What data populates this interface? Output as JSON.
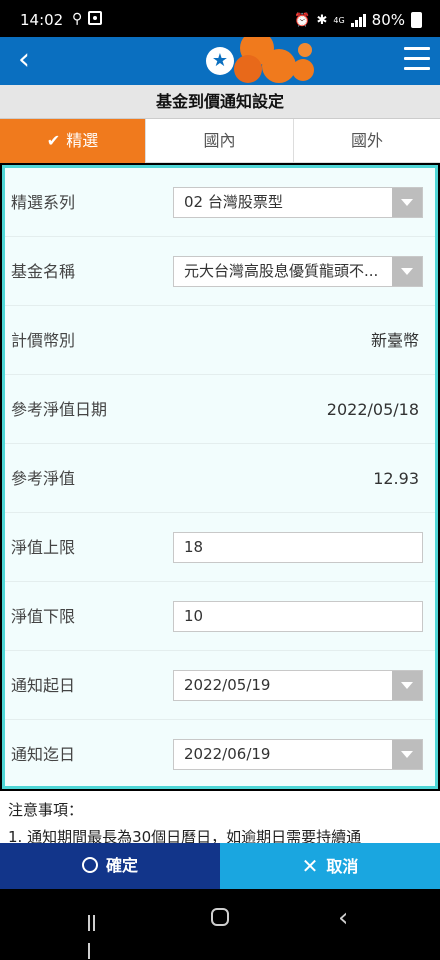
{
  "status_bar": {
    "time": "14:02",
    "network": "4G",
    "battery": "80%"
  },
  "app_bar": {
    "back_icon": "chevron-left-icon",
    "menu_icon": "hamburger-icon",
    "logo_icon": "bank-logo-icon"
  },
  "page_title": "基金到價通知設定",
  "tabs": [
    {
      "label": "精選",
      "active": true
    },
    {
      "label": "國內",
      "active": false
    },
    {
      "label": "國外",
      "active": false
    }
  ],
  "form": {
    "series": {
      "label": "精選系列",
      "value": "02 台灣股票型"
    },
    "fund_name": {
      "label": "基金名稱",
      "value": "元大台灣高股息優質龍頭不..."
    },
    "currency": {
      "label": "計價幣別",
      "value": "新臺幣"
    },
    "nav_date": {
      "label": "參考淨值日期",
      "value": "2022/05/18"
    },
    "nav": {
      "label": "參考淨值",
      "value": "12.93"
    },
    "upper_limit": {
      "label": "淨值上限",
      "value": "18"
    },
    "lower_limit": {
      "label": "淨值下限",
      "value": "10"
    },
    "start_date": {
      "label": "通知起日",
      "value": "2022/05/19"
    },
    "end_date": {
      "label": "通知迄日",
      "value": "2022/06/19"
    }
  },
  "notes": {
    "title": "注意事項：",
    "item_1": "1. 通知期間最長為30個日曆日，如逾期日需要持續通"
  },
  "actions": {
    "confirm": "確定",
    "cancel": "取消"
  },
  "colors": {
    "header_blue": "#0a6fc0",
    "tab_active": "#f07a1d",
    "form_border": "#4fd6d6",
    "confirm_bg": "#12358a",
    "cancel_bg": "#1aa6e0"
  }
}
